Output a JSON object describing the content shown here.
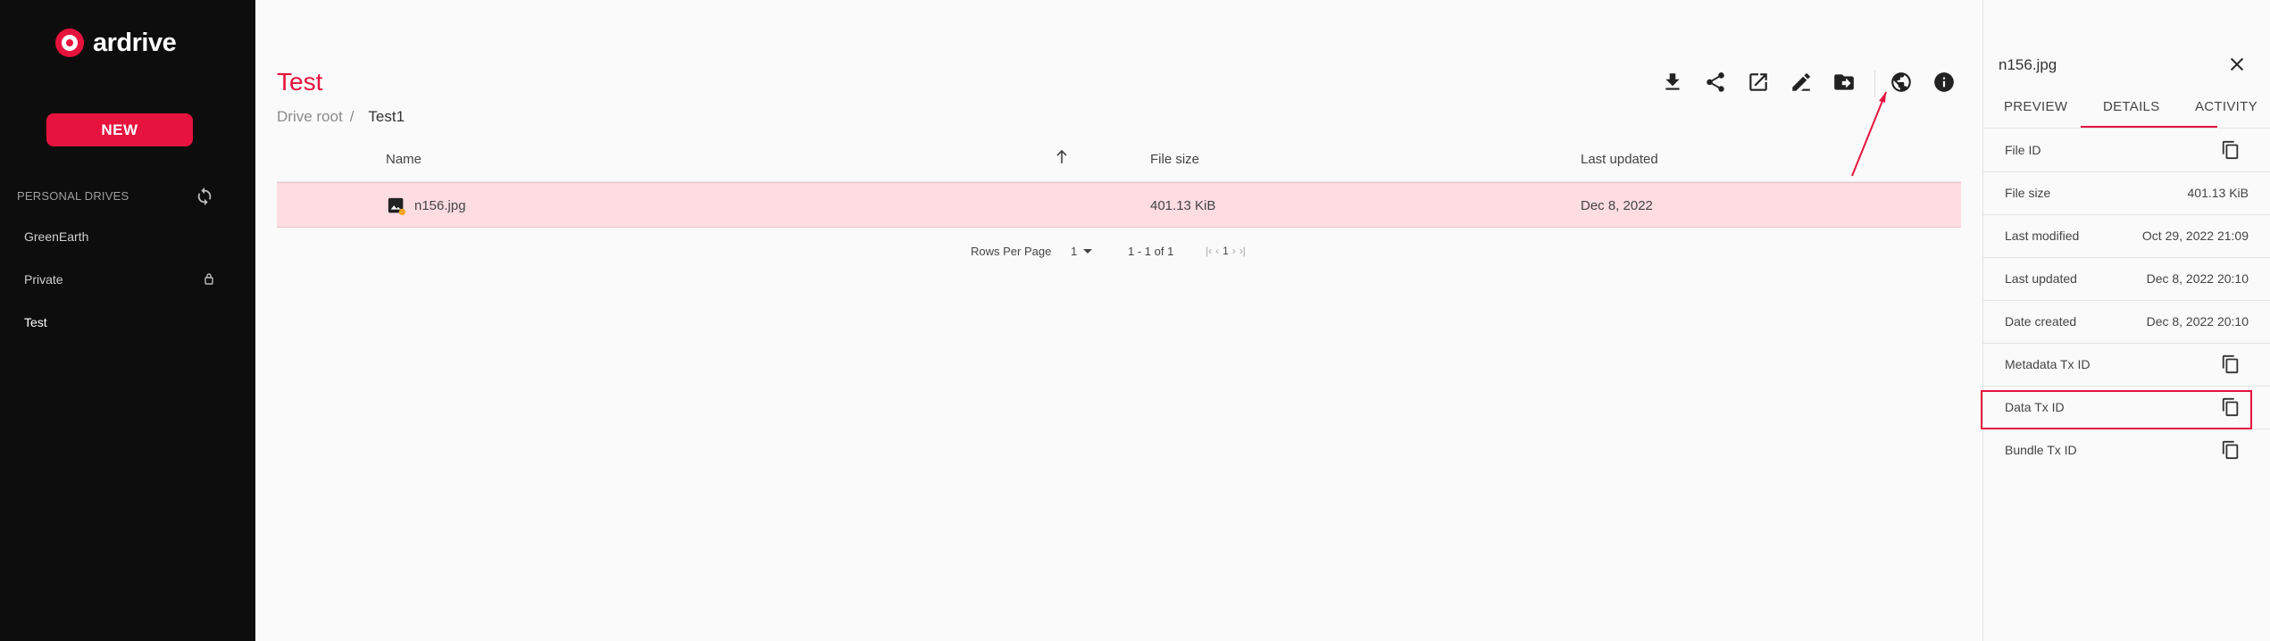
{
  "brand": {
    "name": "ardrive"
  },
  "sidebar": {
    "new_button": "NEW",
    "drives_label": "PERSONAL DRIVES",
    "drives": [
      {
        "label": "GreenEarth",
        "locked": false
      },
      {
        "label": "Private",
        "locked": true
      },
      {
        "label": "Test",
        "locked": false,
        "active": true
      }
    ]
  },
  "main": {
    "title": "Test",
    "breadcrumb": {
      "root": "Drive root",
      "separator": "/",
      "current": "Test1"
    },
    "toolbar": [
      "download-icon",
      "share-icon",
      "open-external-icon",
      "rename-icon",
      "move-icon",
      "globe-icon",
      "info-icon"
    ],
    "table": {
      "columns": [
        "Name",
        "File size",
        "Last updated"
      ],
      "rows": [
        {
          "name": "n156.jpg",
          "size": "401.13 KiB",
          "updated": "Dec 8, 2022"
        }
      ]
    },
    "pagination": {
      "rows_per_page_label": "Rows Per Page",
      "rows_per_page_value": "1",
      "range": "1 - 1 of 1",
      "page": "1"
    }
  },
  "details": {
    "title": "n156.jpg",
    "tabs": [
      "PREVIEW",
      "DETAILS",
      "ACTIVITY"
    ],
    "active_tab": "DETAILS",
    "rows": [
      {
        "label": "File ID",
        "value": ""
      },
      {
        "label": "File size",
        "value": "401.13 KiB"
      },
      {
        "label": "Last modified",
        "value": "Oct 29, 2022 21:09"
      },
      {
        "label": "Last updated",
        "value": "Dec 8, 2022 20:10"
      },
      {
        "label": "Date created",
        "value": "Dec 8, 2022 20:10"
      },
      {
        "label": "Metadata Tx ID",
        "value": ""
      },
      {
        "label": "Data Tx ID",
        "value": ""
      },
      {
        "label": "Bundle Tx ID",
        "value": ""
      }
    ]
  },
  "colors": {
    "accent": "#e5133d",
    "sidebar_bg": "#0d0d0d",
    "selected_row": "#fddce2"
  }
}
